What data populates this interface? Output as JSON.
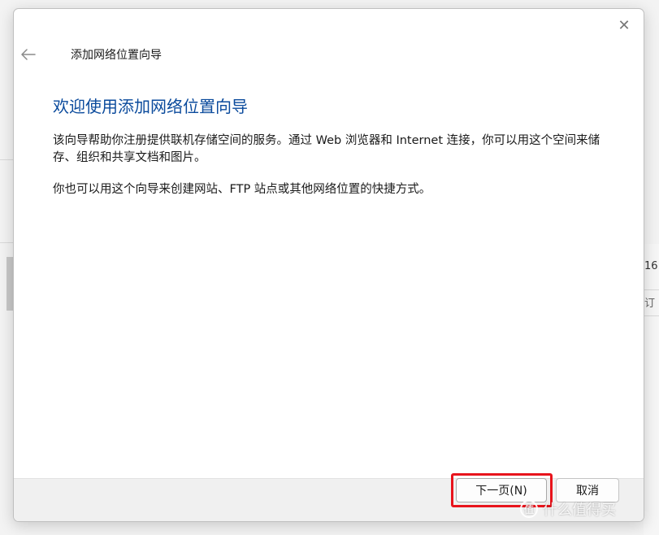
{
  "background": {
    "fragment_1": "16",
    "fragment_2": "订"
  },
  "dialog": {
    "close_icon": "✕",
    "back_icon": "arrow-left",
    "wizard_title": "添加网络位置向导",
    "heading": "欢迎使用添加网络位置向导",
    "paragraph_1": "该向导帮助你注册提供联机存储空间的服务。通过 Web 浏览器和 Internet 连接，你可以用这个空间来储存、组织和共享文档和图片。",
    "paragraph_2": "你也可以用这个向导来创建网站、FTP 站点或其他网络位置的快捷方式。",
    "buttons": {
      "next_label": "下一页(N)",
      "cancel_label": "取消"
    }
  },
  "watermark": {
    "text": "什么值得买",
    "mark": "值"
  },
  "colors": {
    "heading": "#0a4a9c",
    "highlight": "#e8141c",
    "footer_bg": "#f0f0f0"
  }
}
